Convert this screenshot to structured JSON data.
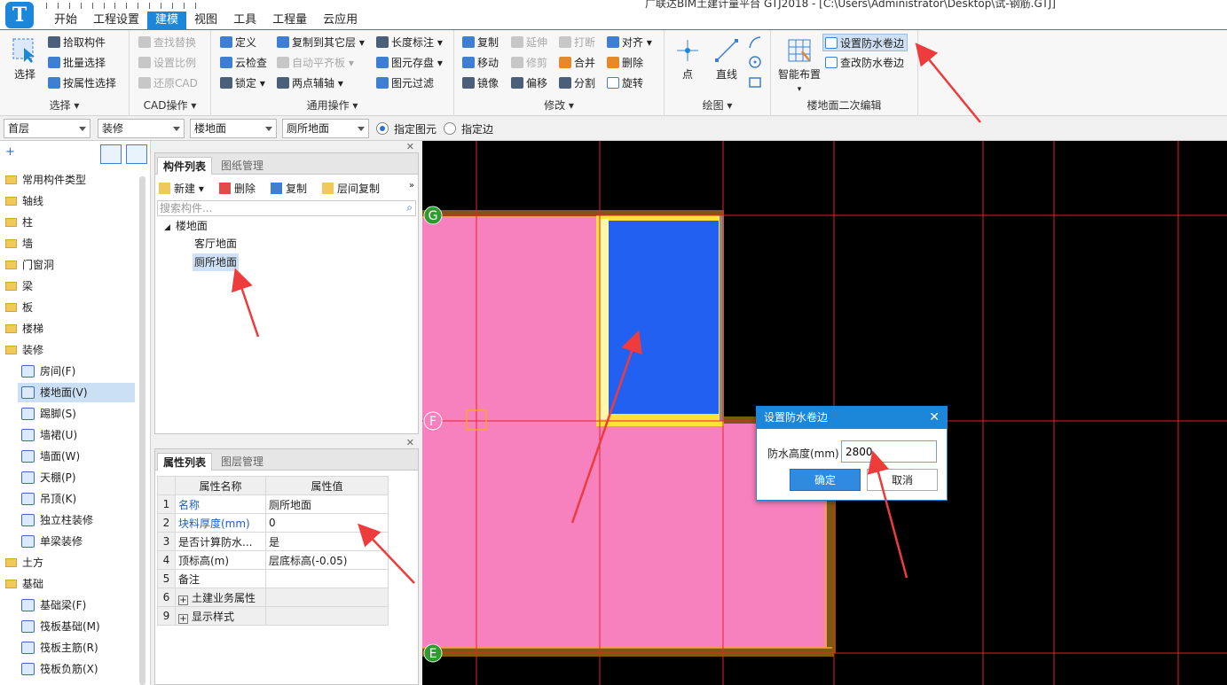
{
  "window": {
    "title": "广联达BIM土建计量平台 GTJ2018 - [C:\\Users\\Administrator\\Desktop\\试-钢筋.GTJ]",
    "logo_letter": "T"
  },
  "menu": {
    "tabs": [
      "开始",
      "工程设置",
      "建模",
      "视图",
      "工具",
      "工程量",
      "云应用"
    ],
    "active": "建模"
  },
  "ribbon": {
    "select": {
      "big": "选择",
      "pick": "拾取构件",
      "batch": "批量选择",
      "by_attr": "按属性选择",
      "label": "选择"
    },
    "cad": {
      "find_replace": "查找替换",
      "set_scale": "设置比例",
      "restore_cad": "还原CAD",
      "label": "CAD操作"
    },
    "general": {
      "define": "定义",
      "copy_to_layer": "复制到其它层",
      "length_mark": "长度标注",
      "cloud_check": "云检查",
      "auto_flat": "自动平齐板",
      "elem_save": "图元存盘",
      "lock": "锁定",
      "two_point_axis": "两点辅轴",
      "elem_filter": "图元过滤",
      "label": "通用操作"
    },
    "modify": {
      "copy": "复制",
      "extend": "延伸",
      "break": "打断",
      "align": "对齐",
      "move": "移动",
      "trim": "修剪",
      "merge": "合并",
      "delete": "删除",
      "mirror": "镜像",
      "offset": "偏移",
      "split": "分割",
      "rotate": "旋转",
      "label": "修改"
    },
    "draw": {
      "point": "点",
      "line": "直线",
      "label": "绘图"
    },
    "floor_edit": {
      "smart": "智能布置",
      "set_waterproof": "设置防水卷边",
      "edit_waterproof": "查改防水卷边",
      "label": "楼地面二次编辑"
    }
  },
  "filters": {
    "floor": "首层",
    "category": "装修",
    "type": "楼地面",
    "component": "厕所地面",
    "radio_element": "指定图元",
    "radio_edge": "指定边",
    "radio_selected": "element"
  },
  "nav": {
    "items": [
      {
        "label": "常用构件类型",
        "kind": "folder"
      },
      {
        "label": "轴线",
        "kind": "folder"
      },
      {
        "label": "柱",
        "kind": "folder"
      },
      {
        "label": "墙",
        "kind": "folder"
      },
      {
        "label": "门窗洞",
        "kind": "folder"
      },
      {
        "label": "梁",
        "kind": "folder"
      },
      {
        "label": "板",
        "kind": "folder"
      },
      {
        "label": "楼梯",
        "kind": "folder"
      },
      {
        "label": "装修",
        "kind": "folder-open"
      },
      {
        "label": "房间(F)",
        "kind": "sub"
      },
      {
        "label": "楼地面(V)",
        "kind": "sub",
        "selected": true
      },
      {
        "label": "踢脚(S)",
        "kind": "sub"
      },
      {
        "label": "墙裙(U)",
        "kind": "sub"
      },
      {
        "label": "墙面(W)",
        "kind": "sub"
      },
      {
        "label": "天棚(P)",
        "kind": "sub"
      },
      {
        "label": "吊顶(K)",
        "kind": "sub"
      },
      {
        "label": "独立柱装修",
        "kind": "sub"
      },
      {
        "label": "单梁装修",
        "kind": "sub"
      },
      {
        "label": "土方",
        "kind": "folder"
      },
      {
        "label": "基础",
        "kind": "folder-open"
      },
      {
        "label": "基础梁(F)",
        "kind": "sub"
      },
      {
        "label": "筏板基础(M)",
        "kind": "sub"
      },
      {
        "label": "筏板主筋(R)",
        "kind": "sub"
      },
      {
        "label": "筏板负筋(X)",
        "kind": "sub"
      }
    ]
  },
  "component_panel": {
    "tabs": [
      "构件列表",
      "图纸管理"
    ],
    "tools": {
      "new": "新建",
      "delete": "删除",
      "copy": "复制",
      "layer_copy": "层间复制"
    },
    "search_placeholder": "搜索构件...",
    "tree": {
      "root": "楼地面",
      "children": [
        "客厅地面",
        "厕所地面"
      ],
      "selected": "厕所地面"
    }
  },
  "prop_panel": {
    "tabs": [
      "属性列表",
      "图层管理"
    ],
    "headers": [
      "属性名称",
      "属性值"
    ],
    "rows": [
      {
        "num": "1",
        "name": "名称",
        "value": "厕所地面",
        "blue": true
      },
      {
        "num": "2",
        "name": "块料厚度(mm)",
        "value": "0",
        "blue": true
      },
      {
        "num": "3",
        "name": "是否计算防水...",
        "value": "是",
        "blue": false
      },
      {
        "num": "4",
        "name": "顶标高(m)",
        "value": "层底标高(-0.05)",
        "blue": false
      },
      {
        "num": "5",
        "name": "备注",
        "value": "",
        "blue": false
      },
      {
        "num": "6",
        "name": "土建业务属性",
        "value": "",
        "group": true
      },
      {
        "num": "9",
        "name": "显示样式",
        "value": "",
        "group": true
      }
    ]
  },
  "canvas": {
    "axis_labels": [
      "G",
      "F",
      "E"
    ],
    "colors": {
      "background": "#000000",
      "grid": "#e8212a",
      "floor_pink": "#f781be",
      "floor_blue": "#2160f0",
      "wall_border": "#8b5a00",
      "yellow": "#ffe13a",
      "axis_marker": "#2e9b2e"
    }
  },
  "dialog": {
    "title": "设置防水卷边",
    "label": "防水高度(mm)",
    "value": "2800",
    "ok": "确定",
    "cancel": "取消"
  },
  "colors": {
    "accent": "#1c86d9",
    "annotation_arrow": "#ee3b3b"
  }
}
